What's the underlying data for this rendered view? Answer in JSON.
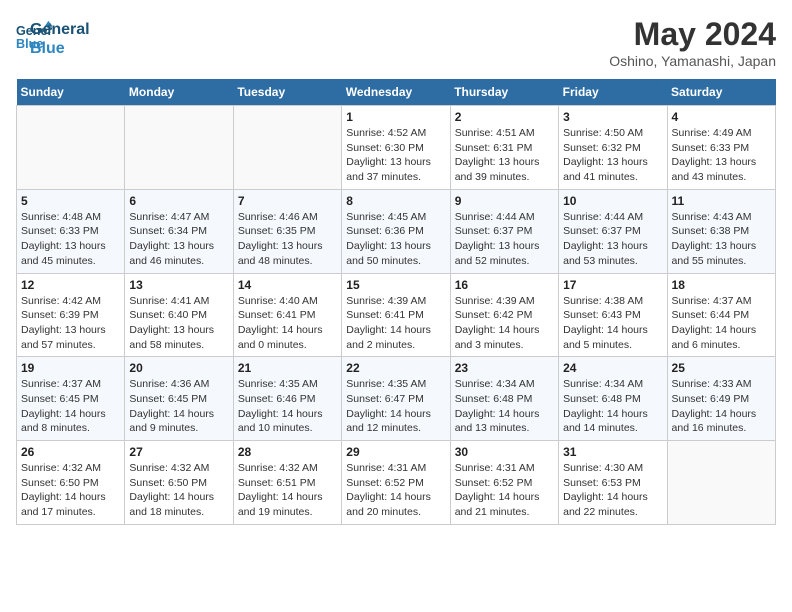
{
  "header": {
    "logo_line1": "General",
    "logo_line2": "Blue",
    "month_year": "May 2024",
    "location": "Oshino, Yamanashi, Japan"
  },
  "weekdays": [
    "Sunday",
    "Monday",
    "Tuesday",
    "Wednesday",
    "Thursday",
    "Friday",
    "Saturday"
  ],
  "weeks": [
    [
      {
        "day": "",
        "info": ""
      },
      {
        "day": "",
        "info": ""
      },
      {
        "day": "",
        "info": ""
      },
      {
        "day": "1",
        "info": "Sunrise: 4:52 AM\nSunset: 6:30 PM\nDaylight: 13 hours and 37 minutes."
      },
      {
        "day": "2",
        "info": "Sunrise: 4:51 AM\nSunset: 6:31 PM\nDaylight: 13 hours and 39 minutes."
      },
      {
        "day": "3",
        "info": "Sunrise: 4:50 AM\nSunset: 6:32 PM\nDaylight: 13 hours and 41 minutes."
      },
      {
        "day": "4",
        "info": "Sunrise: 4:49 AM\nSunset: 6:33 PM\nDaylight: 13 hours and 43 minutes."
      }
    ],
    [
      {
        "day": "5",
        "info": "Sunrise: 4:48 AM\nSunset: 6:33 PM\nDaylight: 13 hours and 45 minutes."
      },
      {
        "day": "6",
        "info": "Sunrise: 4:47 AM\nSunset: 6:34 PM\nDaylight: 13 hours and 46 minutes."
      },
      {
        "day": "7",
        "info": "Sunrise: 4:46 AM\nSunset: 6:35 PM\nDaylight: 13 hours and 48 minutes."
      },
      {
        "day": "8",
        "info": "Sunrise: 4:45 AM\nSunset: 6:36 PM\nDaylight: 13 hours and 50 minutes."
      },
      {
        "day": "9",
        "info": "Sunrise: 4:44 AM\nSunset: 6:37 PM\nDaylight: 13 hours and 52 minutes."
      },
      {
        "day": "10",
        "info": "Sunrise: 4:44 AM\nSunset: 6:37 PM\nDaylight: 13 hours and 53 minutes."
      },
      {
        "day": "11",
        "info": "Sunrise: 4:43 AM\nSunset: 6:38 PM\nDaylight: 13 hours and 55 minutes."
      }
    ],
    [
      {
        "day": "12",
        "info": "Sunrise: 4:42 AM\nSunset: 6:39 PM\nDaylight: 13 hours and 57 minutes."
      },
      {
        "day": "13",
        "info": "Sunrise: 4:41 AM\nSunset: 6:40 PM\nDaylight: 13 hours and 58 minutes."
      },
      {
        "day": "14",
        "info": "Sunrise: 4:40 AM\nSunset: 6:41 PM\nDaylight: 14 hours and 0 minutes."
      },
      {
        "day": "15",
        "info": "Sunrise: 4:39 AM\nSunset: 6:41 PM\nDaylight: 14 hours and 2 minutes."
      },
      {
        "day": "16",
        "info": "Sunrise: 4:39 AM\nSunset: 6:42 PM\nDaylight: 14 hours and 3 minutes."
      },
      {
        "day": "17",
        "info": "Sunrise: 4:38 AM\nSunset: 6:43 PM\nDaylight: 14 hours and 5 minutes."
      },
      {
        "day": "18",
        "info": "Sunrise: 4:37 AM\nSunset: 6:44 PM\nDaylight: 14 hours and 6 minutes."
      }
    ],
    [
      {
        "day": "19",
        "info": "Sunrise: 4:37 AM\nSunset: 6:45 PM\nDaylight: 14 hours and 8 minutes."
      },
      {
        "day": "20",
        "info": "Sunrise: 4:36 AM\nSunset: 6:45 PM\nDaylight: 14 hours and 9 minutes."
      },
      {
        "day": "21",
        "info": "Sunrise: 4:35 AM\nSunset: 6:46 PM\nDaylight: 14 hours and 10 minutes."
      },
      {
        "day": "22",
        "info": "Sunrise: 4:35 AM\nSunset: 6:47 PM\nDaylight: 14 hours and 12 minutes."
      },
      {
        "day": "23",
        "info": "Sunrise: 4:34 AM\nSunset: 6:48 PM\nDaylight: 14 hours and 13 minutes."
      },
      {
        "day": "24",
        "info": "Sunrise: 4:34 AM\nSunset: 6:48 PM\nDaylight: 14 hours and 14 minutes."
      },
      {
        "day": "25",
        "info": "Sunrise: 4:33 AM\nSunset: 6:49 PM\nDaylight: 14 hours and 16 minutes."
      }
    ],
    [
      {
        "day": "26",
        "info": "Sunrise: 4:32 AM\nSunset: 6:50 PM\nDaylight: 14 hours and 17 minutes."
      },
      {
        "day": "27",
        "info": "Sunrise: 4:32 AM\nSunset: 6:50 PM\nDaylight: 14 hours and 18 minutes."
      },
      {
        "day": "28",
        "info": "Sunrise: 4:32 AM\nSunset: 6:51 PM\nDaylight: 14 hours and 19 minutes."
      },
      {
        "day": "29",
        "info": "Sunrise: 4:31 AM\nSunset: 6:52 PM\nDaylight: 14 hours and 20 minutes."
      },
      {
        "day": "30",
        "info": "Sunrise: 4:31 AM\nSunset: 6:52 PM\nDaylight: 14 hours and 21 minutes."
      },
      {
        "day": "31",
        "info": "Sunrise: 4:30 AM\nSunset: 6:53 PM\nDaylight: 14 hours and 22 minutes."
      },
      {
        "day": "",
        "info": ""
      }
    ]
  ]
}
